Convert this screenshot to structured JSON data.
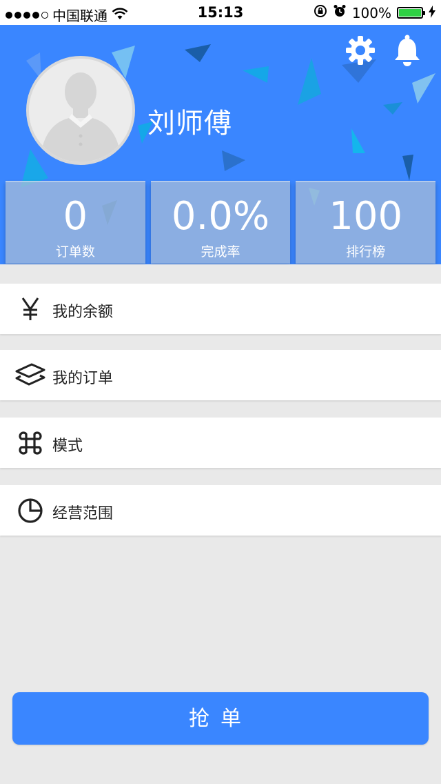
{
  "status_bar": {
    "carrier": "中国联通",
    "time": "15:13",
    "battery_percent": "100%",
    "battery_color": "#2fd144"
  },
  "header": {
    "background_color": "#3a86ff",
    "username": "刘师傅",
    "icons": [
      "gear-icon",
      "bell-icon"
    ]
  },
  "stats": [
    {
      "value": "0",
      "label": "订单数"
    },
    {
      "value": "0.0%",
      "label": "完成率"
    },
    {
      "value": "100",
      "label": "排行榜"
    }
  ],
  "menu": [
    {
      "label": "我的余额",
      "icon": "yen-icon"
    },
    {
      "label": "我的订单",
      "icon": "layers-icon"
    },
    {
      "label": "模式",
      "icon": "command-icon"
    },
    {
      "label": "经营范围",
      "icon": "pie-chart-icon"
    }
  ],
  "action_button": {
    "label": "抢单"
  }
}
